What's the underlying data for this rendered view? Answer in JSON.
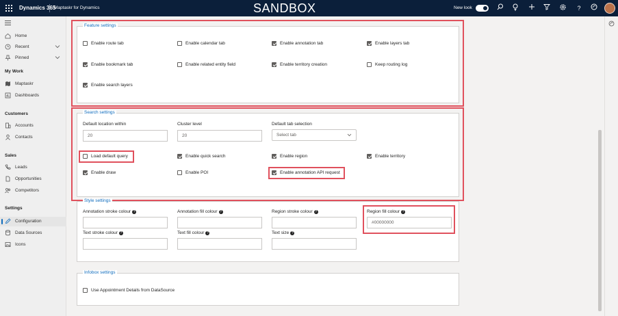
{
  "topbar": {
    "app_name": "Dynamics 365",
    "module": "Maptaskr for Dynamics",
    "environment": "SANDBOX",
    "new_look_label": "New look",
    "new_look_on": true,
    "icons": [
      "waffle-icon",
      "search-icon",
      "lightbulb-icon",
      "plus-icon",
      "filter-icon",
      "settings-icon",
      "help-icon",
      "copilot-icon",
      "avatar"
    ]
  },
  "sidebar": {
    "top_items": [
      {
        "label": "Home",
        "icon": "home-icon"
      },
      {
        "label": "Recent",
        "icon": "clock-icon",
        "chevron": true
      },
      {
        "label": "Pinned",
        "icon": "pin-icon",
        "chevron": true
      }
    ],
    "groups": [
      {
        "heading": "My Work",
        "items": [
          {
            "label": "Maptaskr",
            "icon": "map-icon"
          },
          {
            "label": "Dashboards",
            "icon": "dashboard-icon"
          }
        ]
      },
      {
        "heading": "Customers",
        "items": [
          {
            "label": "Accounts",
            "icon": "building-icon"
          },
          {
            "label": "Contacts",
            "icon": "person-icon"
          }
        ]
      },
      {
        "heading": "Sales",
        "items": [
          {
            "label": "Leads",
            "icon": "phone-icon"
          },
          {
            "label": "Opportunities",
            "icon": "document-icon"
          },
          {
            "label": "Competitors",
            "icon": "people-icon"
          }
        ]
      },
      {
        "heading": "Settings",
        "items": [
          {
            "label": "Configuration",
            "icon": "pencil-icon",
            "active": true
          },
          {
            "label": "Data Sources",
            "icon": "database-icon"
          },
          {
            "label": "Icons",
            "icon": "image-icon"
          }
        ]
      }
    ]
  },
  "feature_settings": {
    "title": "Feature settings",
    "options": [
      {
        "label": "Enable route tab",
        "checked": false
      },
      {
        "label": "Enable calendar tab",
        "checked": false
      },
      {
        "label": "Enable annotation tab",
        "checked": true
      },
      {
        "label": "Enable layers tab",
        "checked": true
      },
      {
        "label": "Enable bookmark tab",
        "checked": true
      },
      {
        "label": "Enable related entity field",
        "checked": false
      },
      {
        "label": "Enable territory creation",
        "checked": true
      },
      {
        "label": "Keep routing log",
        "checked": false
      },
      {
        "label": "Enable search layers",
        "checked": true
      }
    ]
  },
  "search_settings": {
    "title": "Search settings",
    "default_location_label": "Default location within",
    "default_location_value": "20",
    "cluster_level_label": "Cluster level",
    "cluster_level_value": "20",
    "default_tab_label": "Default tab selection",
    "default_tab_value": "Select tab",
    "options": [
      {
        "label": "Load default query",
        "checked": false
      },
      {
        "label": "Enable quick search",
        "checked": true
      },
      {
        "label": "Enable region",
        "checked": true
      },
      {
        "label": "Enable territory",
        "checked": true
      },
      {
        "label": "Enable draw",
        "checked": true
      },
      {
        "label": "Enable POI",
        "checked": false
      },
      {
        "label": "Enable annotation API request",
        "checked": true
      }
    ]
  },
  "style_settings": {
    "title": "Style settings",
    "annotation_stroke_label": "Annotation stroke colour",
    "annotation_fill_label": "Annotation fill colour",
    "region_stroke_label": "Region stroke colour",
    "region_fill_label": "Region fill colour",
    "region_fill_value": "#00000000",
    "text_stroke_label": "Text stroke colour",
    "text_fill_label": "Text fill colour",
    "text_size_label": "Text size",
    "help_glyph": "?"
  },
  "infobox_settings": {
    "title": "Infobox settings",
    "options": [
      {
        "label": "Use Appointment Details from DataSource",
        "checked": false
      }
    ]
  },
  "colors": {
    "topbar": "#0b1f3a",
    "accent": "#0f6cbd",
    "highlight": "#e0505c"
  }
}
